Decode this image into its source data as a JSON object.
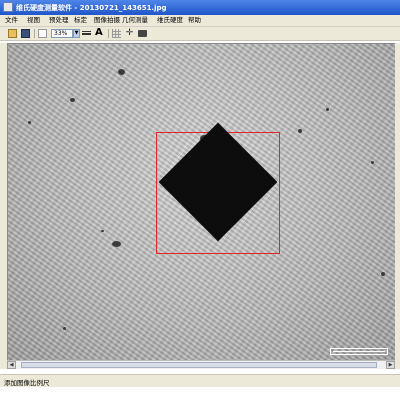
{
  "window": {
    "title": "维氏硬度测量软件 - 20130721_143651.jpg"
  },
  "menu": {
    "items": [
      "文件",
      "视图",
      "预处理",
      "标定",
      "图像拍摄",
      "几何测量",
      "维氏硬度",
      "帮助"
    ]
  },
  "toolbar": {
    "zoom_value": "33%",
    "font_label": "A"
  },
  "icons": [
    "app-icon",
    "open-folder-icon",
    "save-icon",
    "new-page-icon",
    "zoom-dropdown-icon",
    "line-width-icon",
    "font-icon",
    "grid-icon",
    "crosshair-icon",
    "camera-icon"
  ],
  "colors": {
    "measure_box": "#e0282c",
    "titlebar": "#2a5fd6"
  },
  "status": {
    "text": "添加图像比例尺"
  }
}
